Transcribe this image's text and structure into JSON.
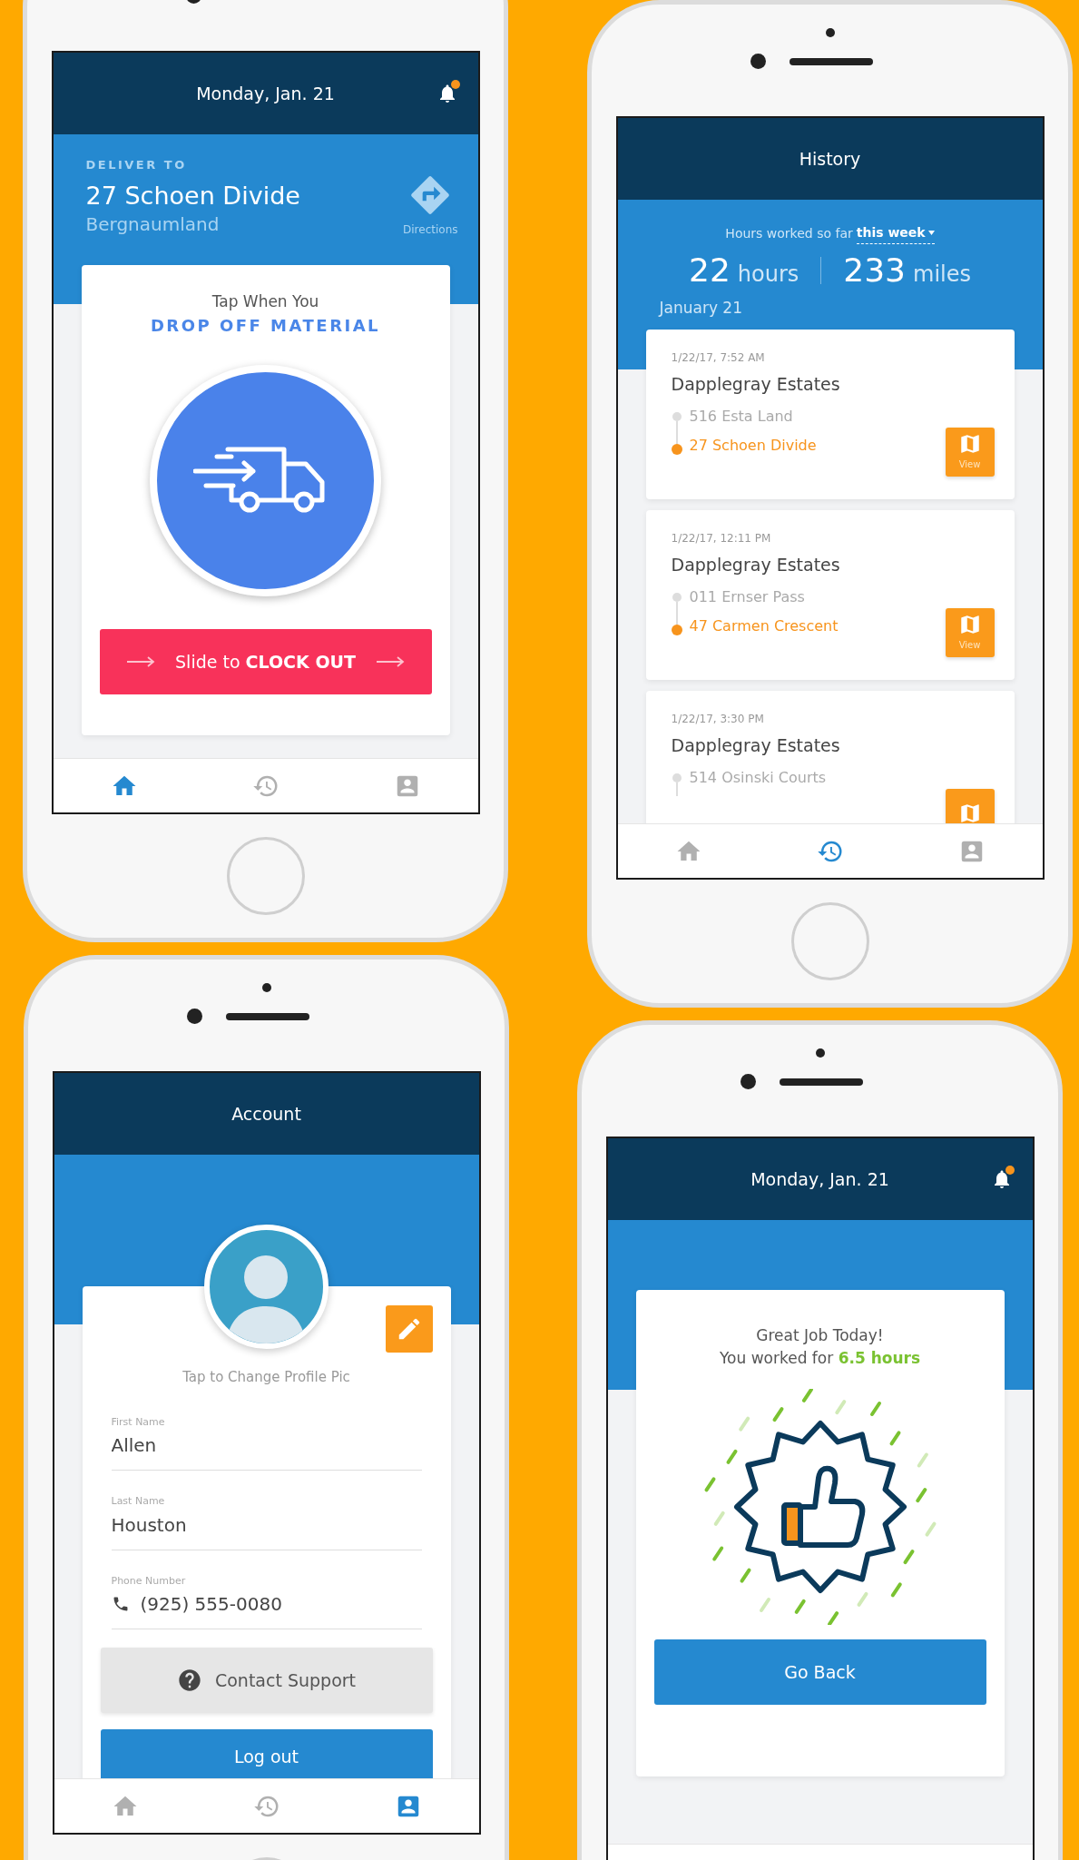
{
  "screens": [
    {
      "kind": "deliver",
      "header": {
        "title": "Monday, Jan. 21",
        "notification": true
      },
      "deliver_label": "DELIVER TO",
      "address": "27 Schoen Divide",
      "city": "Bergnaumland",
      "directions": "Directions",
      "prompt": "Tap When You",
      "action": "DROP OFF MATERIAL",
      "slide": "Slide to **CLOCK OUT**",
      "nav": [
        {
          "kind": "home",
          "selected": true
        },
        {
          "kind": "history",
          "selected": false
        },
        {
          "kind": "account",
          "selected": false
        }
      ]
    },
    {
      "kind": "history",
      "header": {
        "title": "History"
      },
      "hours_label": "Hours worked so far",
      "period": "this week",
      "hours": "22",
      "hours_unit": "hours",
      "miles": "233",
      "miles_unit": "miles",
      "date_heading": "January 21",
      "trips": [
        {
          "time": "1/22/17, 7:52 AM",
          "place": "Dapplegray Estates",
          "from": "516 Esta Land",
          "to": "27 Schoen Divide",
          "view": "View"
        },
        {
          "time": "1/22/17, 12:11 PM",
          "place": "Dapplegray Estates",
          "from": "011 Ernser Pass",
          "to": "47 Carmen Crescent",
          "view": "View"
        },
        {
          "time": "1/22/17, 3:30 PM",
          "place": "Dapplegray Estates",
          "from": "514 Osinski Courts"
        }
      ],
      "nav": [
        {
          "kind": "home",
          "selected": false
        },
        {
          "kind": "history",
          "selected": true
        },
        {
          "kind": "account",
          "selected": false
        }
      ]
    },
    {
      "kind": "account",
      "header": {
        "title": "Account"
      },
      "photo_hint": "Tap to Change Profile Pic",
      "fields": [
        {
          "kind": "text",
          "label": "First Name",
          "value": "Allen"
        },
        {
          "kind": "text",
          "label": "Last Name",
          "value": "Houston"
        },
        {
          "kind": "phone",
          "label": "Phone Number",
          "value": "(925) 555-0080"
        }
      ],
      "support": "Contact Support",
      "logout": "Log out",
      "nav": [
        {
          "kind": "home",
          "selected": false
        },
        {
          "kind": "history",
          "selected": false
        },
        {
          "kind": "account",
          "selected": true
        }
      ]
    },
    {
      "kind": "summary",
      "header": {
        "title": "Monday, Jan. 21",
        "notification": true
      },
      "title": "Great Job Today!",
      "message": "You worked for **6.5 hours**",
      "button": "Go Back"
    }
  ]
}
